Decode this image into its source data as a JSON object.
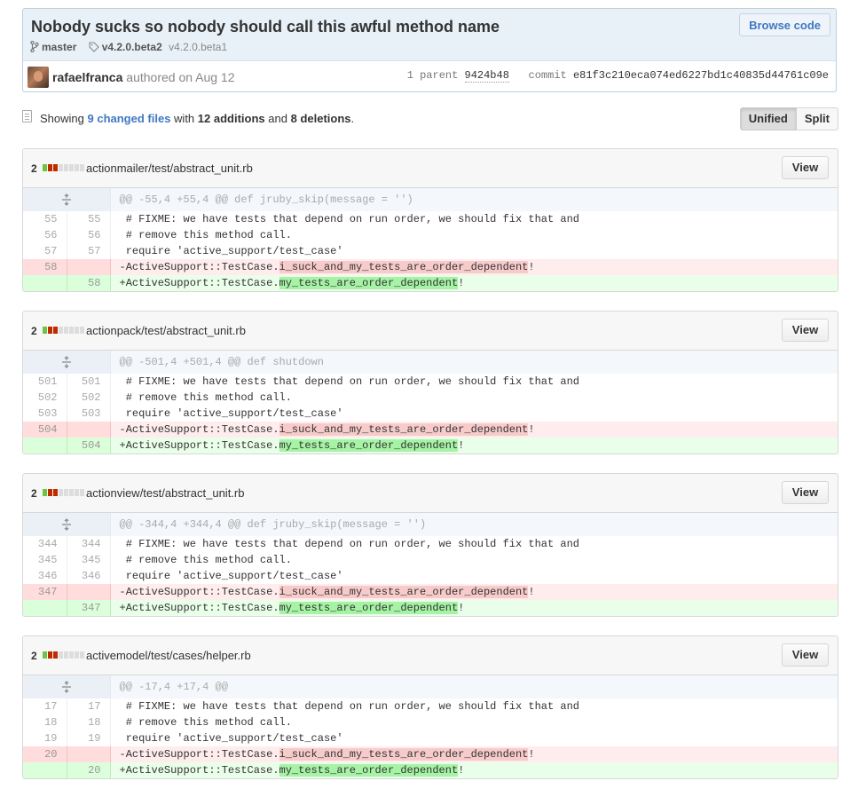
{
  "commit": {
    "title": "Nobody sucks so nobody should call this awful method name",
    "browse_label": "Browse code",
    "branch": "master",
    "tag_primary": "v4.2.0.beta2",
    "tag_secondary": "v4.2.0.beta1",
    "author": "rafaelfranca",
    "authored": "authored on Aug 12",
    "parent_label": "1 parent",
    "parent_sha": "9424b48",
    "commit_label": "commit",
    "commit_sha": "e81f3c210eca074ed6227bd1c40835d44761c09e"
  },
  "toolbar": {
    "showing": "Showing",
    "changed_files": "9 changed files",
    "with": "with",
    "additions": "12 additions",
    "and": "and",
    "deletions": "8 deletions",
    "period": ".",
    "unified_label": "Unified",
    "split_label": "Split"
  },
  "colors": {
    "addition": "#6cc644",
    "deletion": "#bd2c00",
    "link": "#4078c0"
  },
  "files": [
    {
      "count": "2",
      "path": "actionmailer/test/abstract_unit.rb",
      "view_label": "View",
      "hunk": "@@ -55,4 +55,4 @@ def jruby_skip(message = '')",
      "lines": [
        {
          "old": "55",
          "new": "55",
          "text": " # FIXME: we have tests that depend on run order, we should fix that and"
        },
        {
          "old": "56",
          "new": "56",
          "text": " # remove this method call."
        },
        {
          "old": "57",
          "new": "57",
          "text": " require 'active_support/test_case'"
        }
      ],
      "del": {
        "old": "58",
        "prefix": "-ActiveSupport::TestCase.",
        "changed": "i_suck_and_my_tests_are_order_dependent",
        "suffix": "!"
      },
      "add": {
        "new": "58",
        "prefix": "+ActiveSupport::TestCase.",
        "changed": "my_tests_are_order_dependent",
        "suffix": "!"
      }
    },
    {
      "count": "2",
      "path": "actionpack/test/abstract_unit.rb",
      "view_label": "View",
      "hunk": "@@ -501,4 +501,4 @@ def shutdown",
      "lines": [
        {
          "old": "501",
          "new": "501",
          "text": " # FIXME: we have tests that depend on run order, we should fix that and"
        },
        {
          "old": "502",
          "new": "502",
          "text": " # remove this method call."
        },
        {
          "old": "503",
          "new": "503",
          "text": " require 'active_support/test_case'"
        }
      ],
      "del": {
        "old": "504",
        "prefix": "-ActiveSupport::TestCase.",
        "changed": "i_suck_and_my_tests_are_order_dependent",
        "suffix": "!"
      },
      "add": {
        "new": "504",
        "prefix": "+ActiveSupport::TestCase.",
        "changed": "my_tests_are_order_dependent",
        "suffix": "!"
      }
    },
    {
      "count": "2",
      "path": "actionview/test/abstract_unit.rb",
      "view_label": "View",
      "hunk": "@@ -344,4 +344,4 @@ def jruby_skip(message = '')",
      "lines": [
        {
          "old": "344",
          "new": "344",
          "text": " # FIXME: we have tests that depend on run order, we should fix that and"
        },
        {
          "old": "345",
          "new": "345",
          "text": " # remove this method call."
        },
        {
          "old": "346",
          "new": "346",
          "text": " require 'active_support/test_case'"
        }
      ],
      "del": {
        "old": "347",
        "prefix": "-ActiveSupport::TestCase.",
        "changed": "i_suck_and_my_tests_are_order_dependent",
        "suffix": "!"
      },
      "add": {
        "new": "347",
        "prefix": "+ActiveSupport::TestCase.",
        "changed": "my_tests_are_order_dependent",
        "suffix": "!"
      }
    },
    {
      "count": "2",
      "path": "activemodel/test/cases/helper.rb",
      "view_label": "View",
      "hunk": "@@ -17,4 +17,4 @@",
      "lines": [
        {
          "old": "17",
          "new": "17",
          "text": " # FIXME: we have tests that depend on run order, we should fix that and"
        },
        {
          "old": "18",
          "new": "18",
          "text": " # remove this method call."
        },
        {
          "old": "19",
          "new": "19",
          "text": " require 'active_support/test_case'"
        }
      ],
      "del": {
        "old": "20",
        "prefix": "-ActiveSupport::TestCase.",
        "changed": "i_suck_and_my_tests_are_order_dependent",
        "suffix": "!"
      },
      "add": {
        "new": "20",
        "prefix": "+ActiveSupport::TestCase.",
        "changed": "my_tests_are_order_dependent",
        "suffix": "!"
      }
    }
  ]
}
